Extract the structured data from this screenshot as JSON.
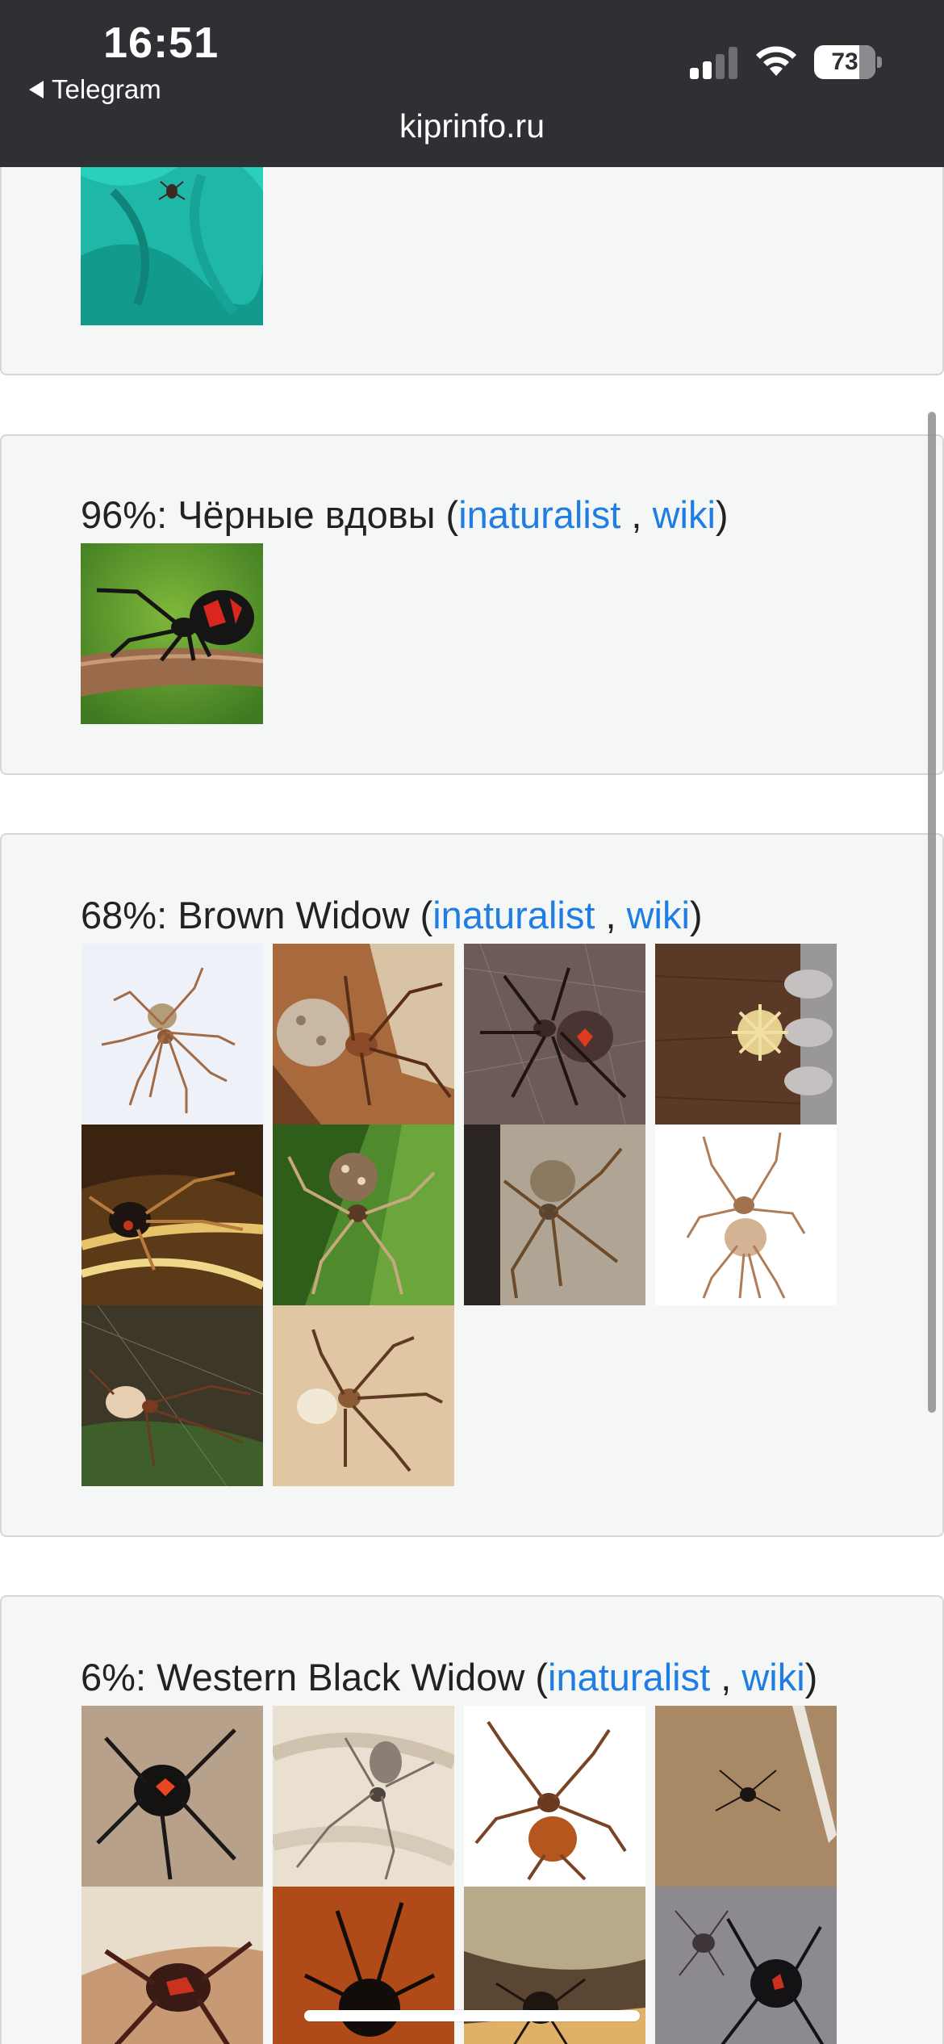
{
  "status_bar": {
    "time": "16:51",
    "back_app": "Telegram",
    "battery": "73"
  },
  "address_bar": {
    "url": "kiprinfo.ru"
  },
  "results": [
    {
      "percent": "96%",
      "separator": ": ",
      "name": "Чёрные вдовы",
      "open_paren": " (",
      "link1": "inaturalist",
      "comma": " , ",
      "link2": "wiki",
      "close_paren": ")"
    },
    {
      "percent": "68%",
      "separator": ": ",
      "name": "Brown Widow",
      "open_paren": " (",
      "link1": "inaturalist",
      "comma": " , ",
      "link2": "wiki",
      "close_paren": ")"
    },
    {
      "percent": "6%",
      "separator": ": ",
      "name": "Western Black Widow",
      "open_paren": " (",
      "link1": "inaturalist",
      "comma": " , ",
      "link2": "wiki",
      "close_paren": ")"
    }
  ],
  "colors": {
    "link": "#1f7de3",
    "topbar": "#2f3033",
    "card_bg": "#f5f6f6"
  }
}
